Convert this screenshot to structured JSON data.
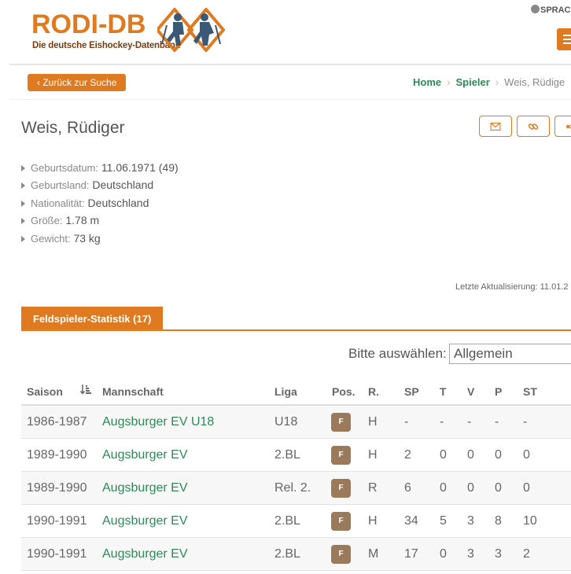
{
  "header": {
    "logo_title": "RODI-DB",
    "logo_subtitle": "Die deutsche Eishockey-Datenbank",
    "language_label": "SPRACH"
  },
  "nav": {
    "back_label": "‹ Zurück zur Suche",
    "breadcrumbs": [
      "Home",
      "Spieler",
      "Weis, Rüdige"
    ]
  },
  "player": {
    "name": "Weis, Rüdiger",
    "details": [
      {
        "label": "Geburtsdatum:",
        "value": "11.06.1971 (49)"
      },
      {
        "label": "Geburtsland:",
        "value": "Deutschland"
      },
      {
        "label": "Nationalität:",
        "value": "Deutschland"
      },
      {
        "label": "Größe:",
        "value": "1.78 m"
      },
      {
        "label": "Gewicht:",
        "value": "73 kg"
      }
    ],
    "last_update": "Letzte Aktualisierung: 11.01.2"
  },
  "stats": {
    "tab_label": "Feldspieler-Statistik (17)",
    "select_label": "Bitte auswählen:",
    "select_value": "Allgemein",
    "columns": [
      "Saison",
      "Mannschaft",
      "Liga",
      "Pos.",
      "R.",
      "SP",
      "T",
      "V",
      "P",
      "ST"
    ],
    "rows": [
      {
        "saison": "1986-1987",
        "team": "Augsburger EV U18",
        "liga": "U18",
        "pos": "F",
        "r": "H",
        "sp": "-",
        "t": "-",
        "v": "-",
        "p": "-",
        "st": "-"
      },
      {
        "saison": "1989-1990",
        "team": "Augsburger EV",
        "liga": "2.BL",
        "pos": "F",
        "r": "H",
        "sp": "2",
        "t": "0",
        "v": "0",
        "p": "0",
        "st": "0"
      },
      {
        "saison": "1989-1990",
        "team": "Augsburger EV",
        "liga": "Rel. 2.",
        "pos": "F",
        "r": "R",
        "sp": "6",
        "t": "0",
        "v": "0",
        "p": "0",
        "st": "0"
      },
      {
        "saison": "1990-1991",
        "team": "Augsburger EV",
        "liga": "2.BL",
        "pos": "F",
        "r": "H",
        "sp": "34",
        "t": "5",
        "v": "3",
        "p": "8",
        "st": "10"
      },
      {
        "saison": "1990-1991",
        "team": "Augsburger EV",
        "liga": "2.BL",
        "pos": "F",
        "r": "M",
        "sp": "17",
        "t": "0",
        "v": "3",
        "p": "3",
        "st": "2"
      }
    ]
  },
  "colors": {
    "accent": "#e07a20",
    "link": "#2e8b57",
    "position_badge": "#9a7a5a"
  },
  "icons": [
    "hockey-players-logo-icon",
    "globe-icon",
    "hamburger-menu-icon",
    "envelope-icon",
    "link-icon",
    "share-icon",
    "sort-descending-icon"
  ]
}
